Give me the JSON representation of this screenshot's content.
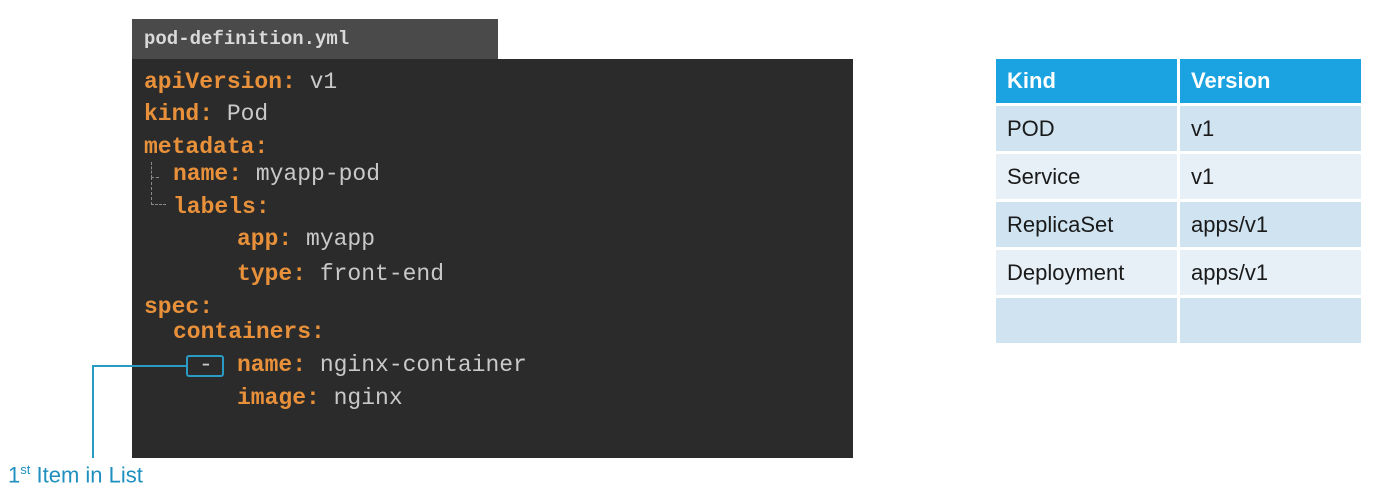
{
  "file": {
    "name": "pod-definition.yml"
  },
  "code": [
    {
      "key": "apiVersion:",
      "value": " v1"
    },
    {
      "key": "kind:",
      "value": " Pod"
    },
    {
      "key": "metadata:",
      "value": ""
    },
    {
      "key": "name:",
      "value": " myapp-pod"
    },
    {
      "key": "labels:",
      "value": ""
    },
    {
      "key": "app:",
      "value": " myapp"
    },
    {
      "key": "type:",
      "value": " front-end"
    },
    {
      "key": "spec:",
      "value": ""
    },
    {
      "key": "containers:",
      "value": ""
    },
    {
      "dash": "-",
      "key": "name:",
      "value": " nginx-container"
    },
    {
      "key": "image:",
      "value": " nginx"
    }
  ],
  "callout": {
    "prefix": "1",
    "superscript": "st",
    "text": " Item in List"
  },
  "table": {
    "headers": [
      "Kind",
      "Version"
    ],
    "rows": [
      [
        "POD",
        "v1"
      ],
      [
        "Service",
        "v1"
      ],
      [
        "ReplicaSet",
        "apps/v1"
      ],
      [
        "Deployment",
        "apps/v1"
      ],
      [
        "",
        ""
      ]
    ]
  },
  "colors": {
    "key": "#e8913a",
    "value": "#c9c9c9",
    "accent": "#2a9bc4",
    "table_header": "#1aa3e0"
  }
}
